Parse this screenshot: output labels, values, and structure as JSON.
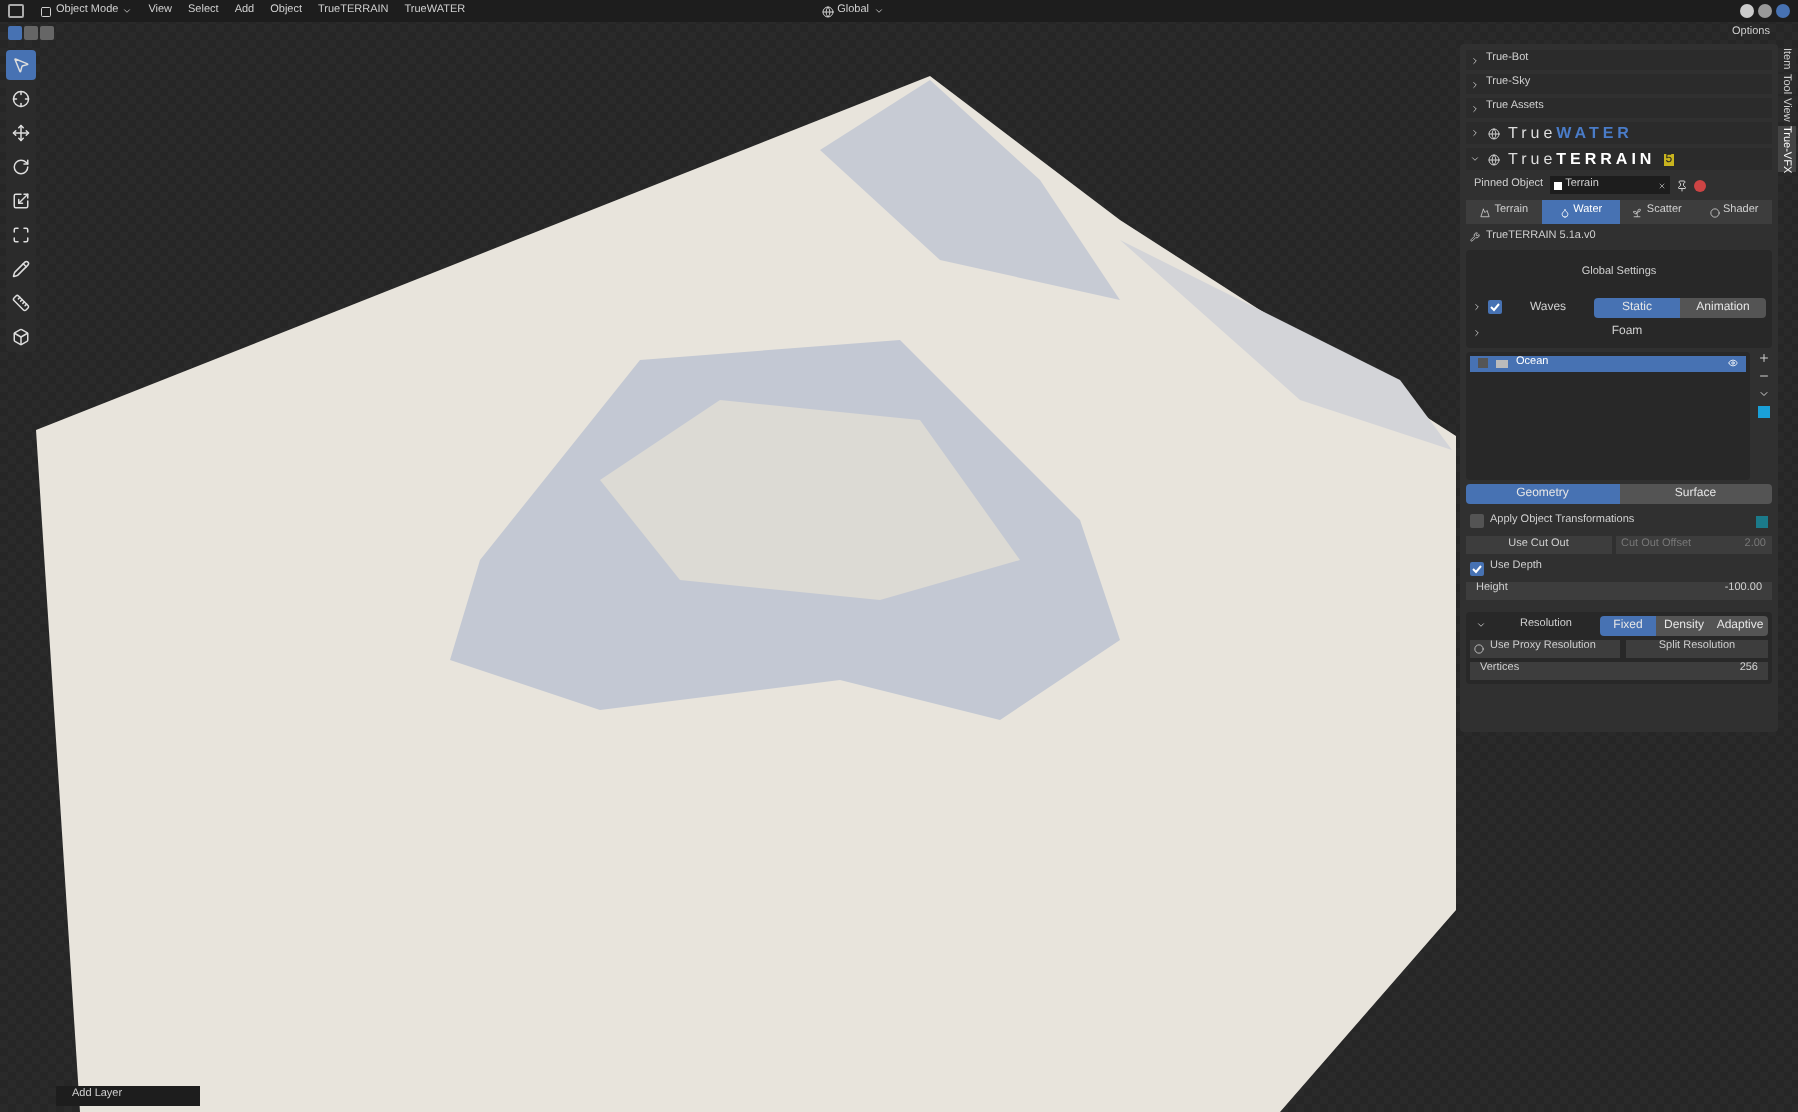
{
  "header": {
    "mode": "Object Mode",
    "menus": [
      {
        "label": "View"
      },
      {
        "label": "Select"
      },
      {
        "label": "Add"
      },
      {
        "label": "Object"
      },
      {
        "label": "TrueTERRAIN"
      },
      {
        "label": "TrueWATER"
      }
    ],
    "orientation": "Global",
    "options": "Options"
  },
  "toolbar": [
    {
      "kind": "cursor",
      "selected": true
    },
    {
      "kind": "target",
      "selected": false
    },
    {
      "kind": "move",
      "selected": false
    },
    {
      "kind": "rotate",
      "selected": false
    },
    {
      "kind": "scale",
      "selected": false
    },
    {
      "kind": "transform",
      "selected": false
    },
    {
      "kind": "annotate",
      "selected": false
    },
    {
      "kind": "measure",
      "selected": false
    },
    {
      "kind": "cube",
      "selected": false
    }
  ],
  "panel": {
    "sections": [
      {
        "label": "True-Bot"
      },
      {
        "label": "True-Sky"
      },
      {
        "label": "True Assets"
      }
    ],
    "brands": [
      {
        "prefix": "True",
        "name": "WATER",
        "expanded": false
      },
      {
        "prefix": "True",
        "name": "TERRAIN",
        "badge": "5",
        "expanded": true
      }
    ],
    "pinned": {
      "label": "Pinned Object",
      "value": "Terrain"
    },
    "tabs": [
      {
        "label": "Terrain",
        "selected": false
      },
      {
        "label": "Water",
        "selected": true
      },
      {
        "label": "Scatter",
        "selected": false
      },
      {
        "label": "Shader",
        "selected": false
      }
    ],
    "version": "TrueTERRAIN 5.1a.v0",
    "global_settings": {
      "title": "Global Settings",
      "waves": {
        "label": "Waves",
        "checked": true,
        "options": [
          {
            "label": "Static",
            "selected": true
          },
          {
            "label": "Animation",
            "selected": false
          }
        ]
      },
      "foam": "Foam"
    },
    "layers": [
      {
        "name": "Ocean",
        "selected": true,
        "visible": true
      }
    ],
    "mode_tabs": [
      {
        "label": "Geometry",
        "selected": true
      },
      {
        "label": "Surface",
        "selected": false
      }
    ],
    "apply_transform": {
      "label": "Apply Object Transformations",
      "checked": false
    },
    "cut_out": {
      "button": "Use Cut Out",
      "offset_label": "Cut Out Offset",
      "offset_value": "2.00",
      "disabled": true
    },
    "use_depth": {
      "label": "Use Depth",
      "checked": true
    },
    "height": {
      "label": "Height",
      "value": "-100.00"
    },
    "resolution": {
      "label": "Resolution",
      "options": [
        {
          "label": "Fixed",
          "selected": true
        },
        {
          "label": "Density",
          "selected": false
        },
        {
          "label": "Adaptive",
          "selected": false
        }
      ],
      "proxy": "Use Proxy Resolution",
      "split": "Split Resolution",
      "vertices_label": "Vertices",
      "vertices_value": "256"
    }
  },
  "side_tabs": [
    {
      "label": "Item",
      "selected": false
    },
    {
      "label": "Tool",
      "selected": false
    },
    {
      "label": "View",
      "selected": false
    },
    {
      "label": "True-VFX",
      "selected": true
    }
  ],
  "footer": {
    "label": "Add Layer"
  }
}
